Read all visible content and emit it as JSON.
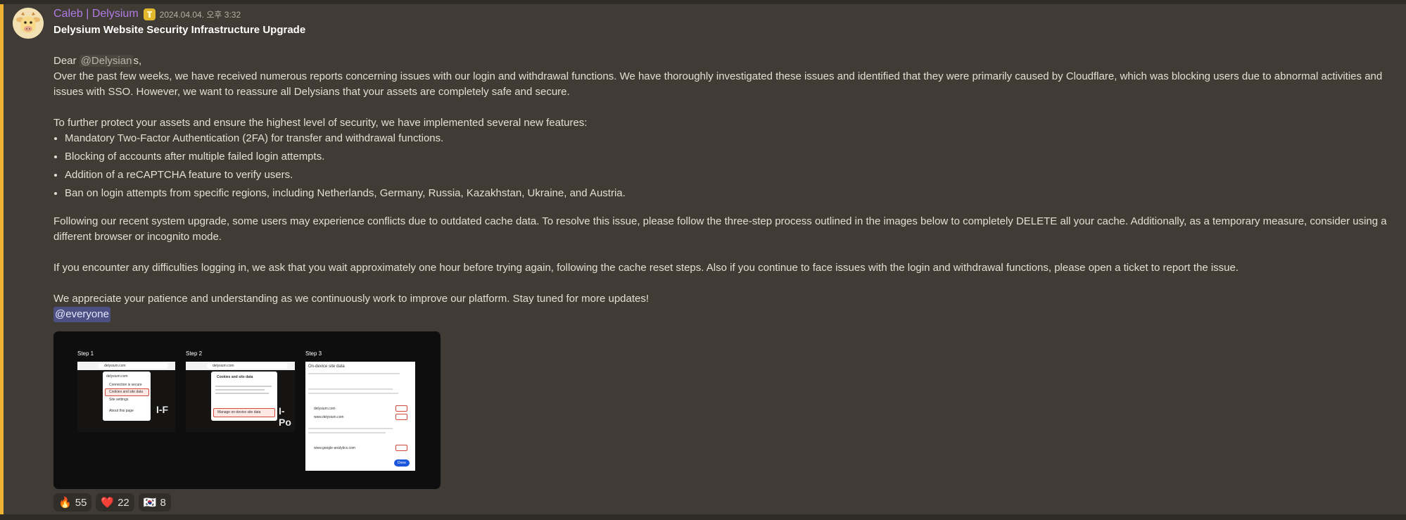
{
  "message": {
    "author": "Caleb | Delysium",
    "timestamp": "2024.04.04. 오후 3:32",
    "title": "Delysium Website Security Infrastructure Upgrade",
    "greeting_prefix": "Dear ",
    "greeting_mention": "@Delysian",
    "greeting_suffix": "s,",
    "para1": "Over the past few weeks, we have received numerous reports concerning issues with our login and withdrawal functions. We have thoroughly investigated these issues and identified that they were primarily caused by Cloudflare, which was blocking users due to abnormal activities and issues with SSO. However, we want to reassure all Delysians that your assets are completely safe and secure.",
    "para2": "To further protect your assets and ensure the highest level of security, we have implemented several new features:",
    "features": [
      "Mandatory Two-Factor Authentication (2FA) for transfer and withdrawal functions.",
      "Blocking of accounts after multiple failed login attempts.",
      "Addition of a reCAPTCHA feature to verify users.",
      "Ban on login attempts from specific regions, including Netherlands, Germany, Russia, Kazakhstan, Ukraine, and Austria."
    ],
    "para3": "Following our recent system upgrade, some users may experience conflicts due to outdated cache data. To resolve this issue, please follow the three-step process outlined in the images below to completely DELETE all your cache. Additionally, as a temporary measure, consider using a different browser or incognito mode.",
    "para4": "If you encounter any difficulties logging in, we ask that you wait approximately one hour before trying again, following the cache reset steps. Also if you continue to face issues with the login and withdrawal functions, please open a ticket to report the issue.",
    "para5": "We appreciate your patience and understanding as we continuously work to improve our platform. Stay tuned for more updates!",
    "everyone": "@everyone"
  },
  "attachment": {
    "step1_label": "Step 1",
    "step2_label": "Step 2",
    "step3_label": "Step 3",
    "url": "delysium.com",
    "step1_menu": [
      "delysium.com",
      "Connection is secure",
      "Cookies and site data",
      "Site settings",
      "About this page"
    ],
    "step2_popup_title": "Cookies and site data",
    "step2_manage": "Manage on-device site data",
    "step3_title": "On-device site data",
    "step3_sites": [
      "delysium.com",
      "www.delysium.com",
      "www.google-analytics.com"
    ],
    "step3_done": "Done"
  },
  "reactions": [
    {
      "emoji": "🔥",
      "count": "55"
    },
    {
      "emoji": "❤️",
      "count": "22"
    },
    {
      "emoji": "🇰🇷",
      "count": "8"
    }
  ],
  "colors": {
    "author": "#b07be6",
    "role_badge": "#e1b72e",
    "mention_bar": "#f0b232",
    "everyone_bg": "#4d5083",
    "background": "#403c35"
  },
  "icons": {
    "role": "role-badge-icon",
    "avatar": "cow-avatar-icon"
  }
}
